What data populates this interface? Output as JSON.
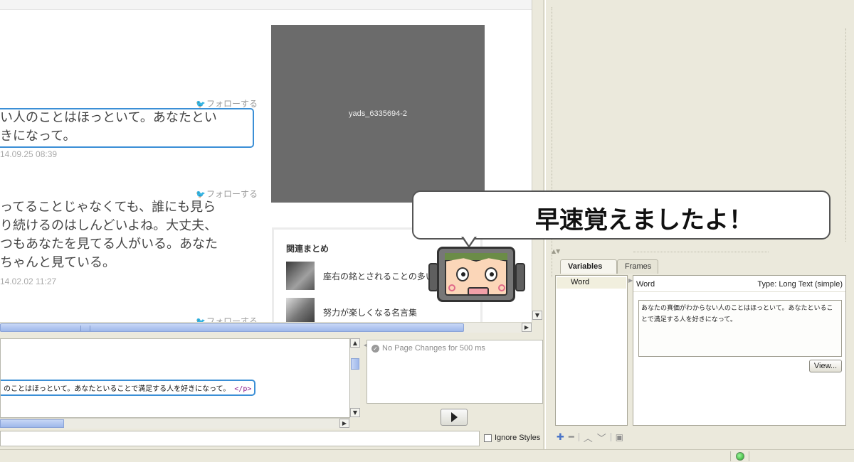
{
  "preview": {
    "tweets": [
      {
        "follow": "フォローする",
        "text_lines": [
          "い人のことはほっといて。あなたとい",
          "きになって。"
        ],
        "date": "14.09.25 08:39"
      },
      {
        "follow": "フォローする",
        "text_lines": [
          "ってることじゃなくても、誰にも見ら",
          "り続けるのはしんどいよね。大丈夫、",
          "つもあなたを見てる人がいる。あなた",
          "ちゃんと見ている。"
        ],
        "date": "14.02.02 11:27"
      },
      {
        "follow": "フォローする"
      }
    ],
    "ad_label": "yads_6335694-2",
    "related": {
      "heading": "関連まとめ",
      "items": [
        {
          "label": "座右の銘とされることの多い"
        },
        {
          "label": "努力が楽しくなる名言集"
        }
      ]
    }
  },
  "source": {
    "code_text": "のことはほっといて。あなたといることで満足する人を好きになって。",
    "code_tag": "</p>"
  },
  "watch": {
    "status": "No Page Changes for 500 ms"
  },
  "ignore_styles_label": "Ignore Styles",
  "right_panel": {
    "tabs": [
      "Variables",
      "Frames"
    ],
    "variables": [
      {
        "name": "Word"
      }
    ],
    "detail": {
      "name": "Word",
      "type": "Type: Long Text (simple)",
      "value": "あなたの真価がわからない人のことはほっといて。あなたといることで満足する人を好きになって。",
      "view_button": "View..."
    }
  },
  "bubble": {
    "text": "早速覚えましたよ！"
  },
  "colors": {
    "highlight": "#3b8fd6",
    "status_led": "#1fa51f",
    "scroll_thumb": "#9eb7ea"
  }
}
